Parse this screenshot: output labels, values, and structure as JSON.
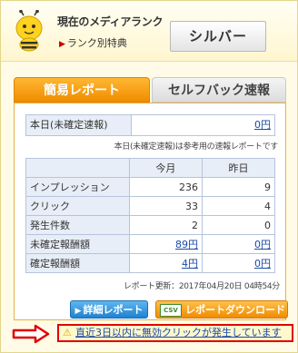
{
  "header": {
    "rank_title": "現在のメディアランク",
    "rank_link": "ランク別特典",
    "rank_value": "シルバー"
  },
  "tabs": [
    {
      "label": "簡易レポート",
      "active": true
    },
    {
      "label": "セルフバック速報",
      "active": false
    }
  ],
  "today": {
    "label": "本日(未確定速報)",
    "value": "0円",
    "note": "本日(未確定速報)は参考用の速報レポートです"
  },
  "stats": {
    "columns": [
      "今月",
      "昨日"
    ],
    "rows": [
      {
        "label": "インプレッション",
        "this_month": "236",
        "yesterday": "9",
        "link": false
      },
      {
        "label": "クリック",
        "this_month": "33",
        "yesterday": "4",
        "link": false
      },
      {
        "label": "発生件数",
        "this_month": "2",
        "yesterday": "0",
        "link": false
      },
      {
        "label": "未確定報酬額",
        "this_month": "89円",
        "yesterday": "0円",
        "link": true
      },
      {
        "label": "確定報酬額",
        "this_month": "4円",
        "yesterday": "0円",
        "link": true
      }
    ]
  },
  "updated": "レポート更新：2017年04月20日 04時54分",
  "buttons": {
    "detail": "詳細レポート",
    "csv_chip": "CSV",
    "download": "レポートダウンロード"
  },
  "alert": {
    "text": "直近3日以内に無効クリックが発生しています"
  },
  "colors": {
    "accent_orange": "#f08c00",
    "link_blue": "#1a4aa8",
    "alert_red": "#e00000"
  }
}
